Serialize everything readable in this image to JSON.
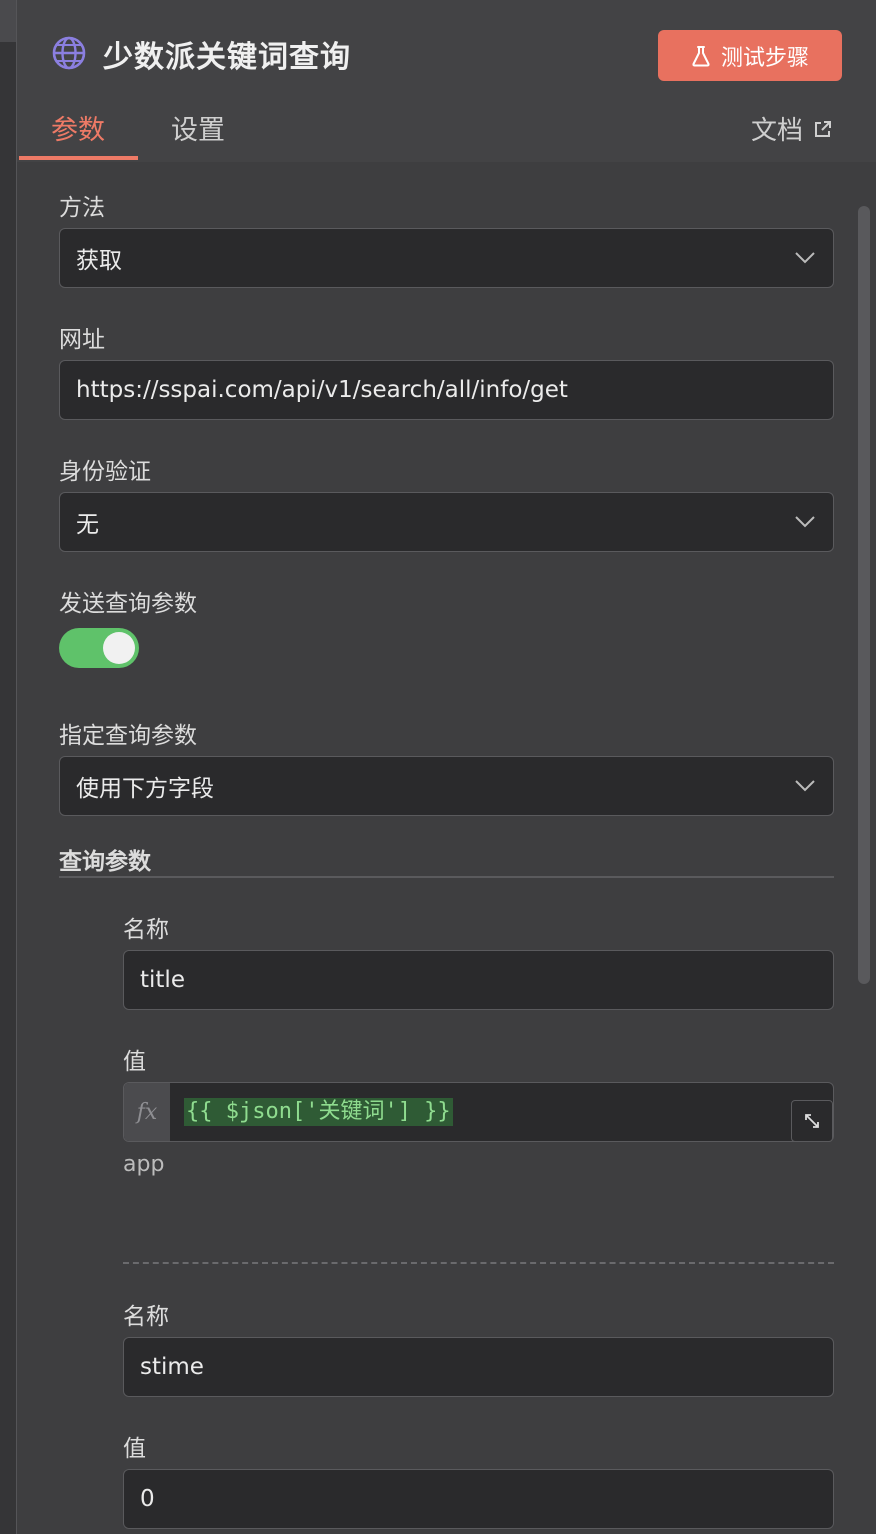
{
  "header": {
    "title": "少数派关键词查询",
    "test_button": "测试步骤",
    "tabs": [
      "参数",
      "设置"
    ],
    "active_tab": "参数",
    "docs_link": "文档"
  },
  "form": {
    "method": {
      "label": "方法",
      "value": "获取"
    },
    "url": {
      "label": "网址",
      "value": "https://sspai.com/api/v1/search/all/info/get"
    },
    "auth": {
      "label": "身份验证",
      "value": "无"
    },
    "send_query": {
      "label": "发送查询参数",
      "enabled": true
    },
    "specify_query": {
      "label": "指定查询参数",
      "value": "使用下方字段"
    },
    "query_section_title": "查询参数",
    "params": [
      {
        "name_label": "名称",
        "name": "title",
        "value_label": "值",
        "fx_symbol": "fx",
        "value_expression": "{{ $json['关键词'] }}",
        "preview": "app"
      },
      {
        "name_label": "名称",
        "name": "stime",
        "value_label": "值",
        "value": "0"
      }
    ]
  },
  "colors": {
    "accent": "#ee7a66",
    "button": "#e8715f",
    "toggle_on": "#5fc26a",
    "panel_bg": "#414143",
    "field_bg": "#2a2a2c",
    "expression_text": "#8fdc8f",
    "expression_bg": "#2f5b35"
  },
  "icons": {
    "node": "globe-icon",
    "test": "flask-icon",
    "docs": "external-link-icon",
    "dropdown": "chevron-down-icon",
    "expand": "expand-icon"
  }
}
